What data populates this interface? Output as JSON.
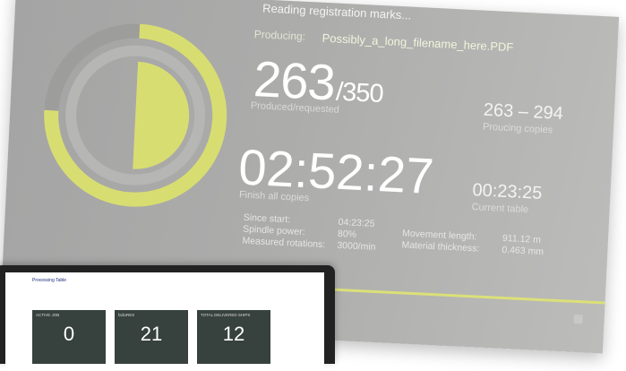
{
  "status_message": "Reading registration marks...",
  "producing": {
    "label": "Producing:",
    "filename": "Possibly_a_long_filename_here.PDF"
  },
  "progress": {
    "produced": "263",
    "requested": "/350",
    "label": "Produced/requested",
    "fraction": 0.7514
  },
  "copies_range": {
    "value": "263 – 294",
    "label": "Proucing copies"
  },
  "finish_time": {
    "value": "02:52:27",
    "label": "Finish all copies"
  },
  "current_table": {
    "value": "00:23:25",
    "label": "Current table"
  },
  "stats": {
    "since_start_label": "Since start:",
    "since_start_value": "04:23:25",
    "spindle_label": "Spindle power:",
    "spindle_value": "80%",
    "rotations_label": "Measured rotations:",
    "rotations_value": "3000/min",
    "movement_label": "Movement length:",
    "movement_value": "911.12 m",
    "thickness_label": "Material thickness:",
    "thickness_value": "0.463 mm"
  },
  "laptop": {
    "title": "Processing Table",
    "tiles": [
      {
        "label": "ACTIVE JOB",
        "value": "0"
      },
      {
        "label": "failURES",
        "value": "21"
      },
      {
        "label": "TOTAL DELIVERED SHIPS",
        "value": "12"
      }
    ]
  },
  "colors": {
    "accent": "#d8dd72",
    "screen_bg": "#a8a8a7",
    "tile_bg": "#37413d"
  }
}
